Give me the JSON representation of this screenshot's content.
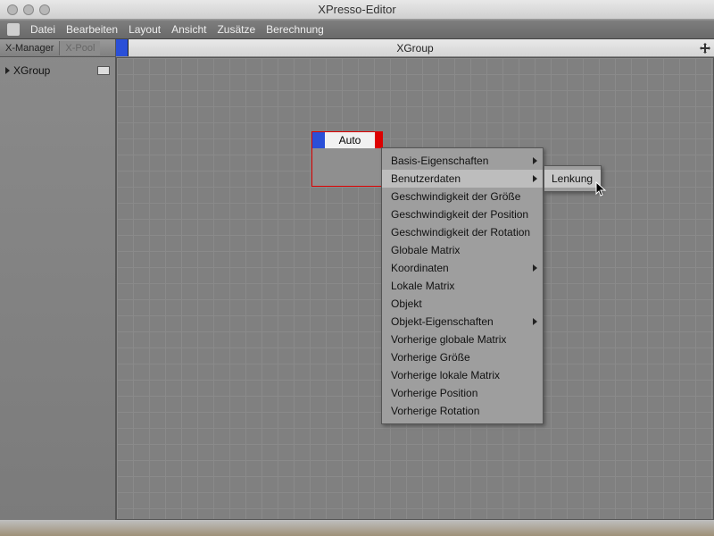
{
  "window": {
    "title": "XPresso-Editor"
  },
  "menubar": {
    "items": [
      "Datei",
      "Bearbeiten",
      "Layout",
      "Ansicht",
      "Zusätze",
      "Berechnung"
    ]
  },
  "left_panel": {
    "tabs": [
      "X-Manager",
      "X-Pool"
    ],
    "tree": {
      "items": [
        {
          "label": "XGroup"
        }
      ]
    }
  },
  "canvas": {
    "title": "XGroup",
    "node": {
      "title": "Auto"
    }
  },
  "context_menu": {
    "items": [
      {
        "label": "Basis-Eigenschaften",
        "submenu": true
      },
      {
        "label": "Benutzerdaten",
        "submenu": true,
        "hover": true
      },
      {
        "label": "Geschwindigkeit der Größe"
      },
      {
        "label": "Geschwindigkeit der Position"
      },
      {
        "label": "Geschwindigkeit der Rotation"
      },
      {
        "label": "Globale Matrix"
      },
      {
        "label": "Koordinaten",
        "submenu": true
      },
      {
        "label": "Lokale Matrix"
      },
      {
        "label": "Objekt"
      },
      {
        "label": "Objekt-Eigenschaften",
        "submenu": true
      },
      {
        "label": "Vorherige globale Matrix"
      },
      {
        "label": "Vorherige Größe"
      },
      {
        "label": "Vorherige lokale Matrix"
      },
      {
        "label": "Vorherige Position"
      },
      {
        "label": "Vorherige Rotation"
      }
    ],
    "submenu": {
      "items": [
        "Lenkung"
      ]
    }
  }
}
